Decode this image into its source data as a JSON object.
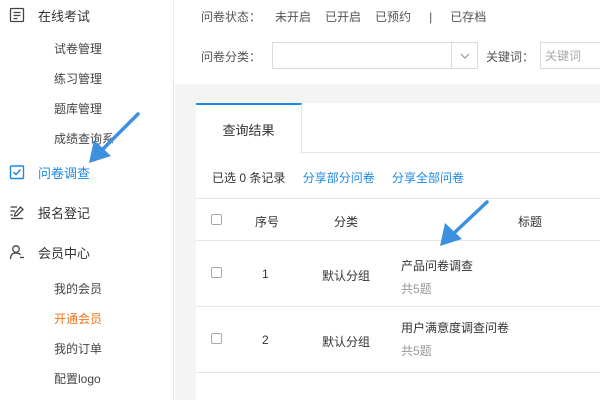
{
  "sidebar": {
    "exam": {
      "label": "在线考试",
      "icon": "list-icon"
    },
    "exam_subitems": [
      "试卷管理",
      "练习管理",
      "题库管理",
      "成绩查询系"
    ],
    "survey": {
      "label": "问卷调查",
      "icon": "checkbox-icon"
    },
    "register": {
      "label": "报名登记",
      "icon": "edit-icon"
    },
    "member": {
      "label": "会员中心",
      "icon": "user-icon"
    },
    "member_subitems": [
      "我的会员",
      "开通会员",
      "我的订单",
      "配置logo"
    ]
  },
  "filter": {
    "status_label": "问卷状态：",
    "status_options": [
      "未开启",
      "已开启",
      "已预约",
      "|",
      "已存档"
    ],
    "category_label": "问卷分类：",
    "keyword_label": "关键词：",
    "keyword_placeholder": "关键词"
  },
  "results": {
    "tab_label": "查询结果",
    "selected_text": "已选 0 条记录",
    "share_selected": "分享部分问卷",
    "share_all": "分享全部问卷",
    "columns": [
      "序号",
      "分类",
      "标题"
    ],
    "rows": [
      {
        "index": "1",
        "category": "默认分组",
        "title": "产品问卷调查",
        "count": "共5题"
      },
      {
        "index": "2",
        "category": "默认分组",
        "title": "用户满意度调查问卷",
        "count": "共5题"
      }
    ]
  },
  "colors": {
    "accent": "#1e88e5",
    "orange": "#f0761e",
    "annotation_arrow": "#3d8fe0"
  }
}
